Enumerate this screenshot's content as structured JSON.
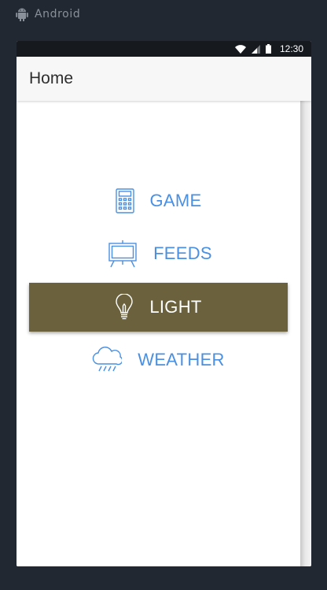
{
  "system": {
    "os_label": "Android",
    "os_icon": "android-icon"
  },
  "status_bar": {
    "time": "12:30",
    "icons": [
      "wifi-icon",
      "signal-icon",
      "battery-icon"
    ]
  },
  "app_bar": {
    "title": "Home"
  },
  "menu": {
    "items": [
      {
        "label": "GAME",
        "icon": "calculator-icon",
        "selected": false
      },
      {
        "label": "FEEDS",
        "icon": "easel-board-icon",
        "selected": false
      },
      {
        "label": "LIGHT",
        "icon": "lightbulb-icon",
        "selected": true
      },
      {
        "label": "WEATHER",
        "icon": "rain-cloud-icon",
        "selected": false
      }
    ]
  },
  "colors": {
    "accent": "#4a90e2",
    "selected_background": "#6b613d",
    "selected_text": "#ffffff",
    "desktop_background": "#222831",
    "status_bar": "#161a1f",
    "app_bar": "#f7f7f7"
  }
}
